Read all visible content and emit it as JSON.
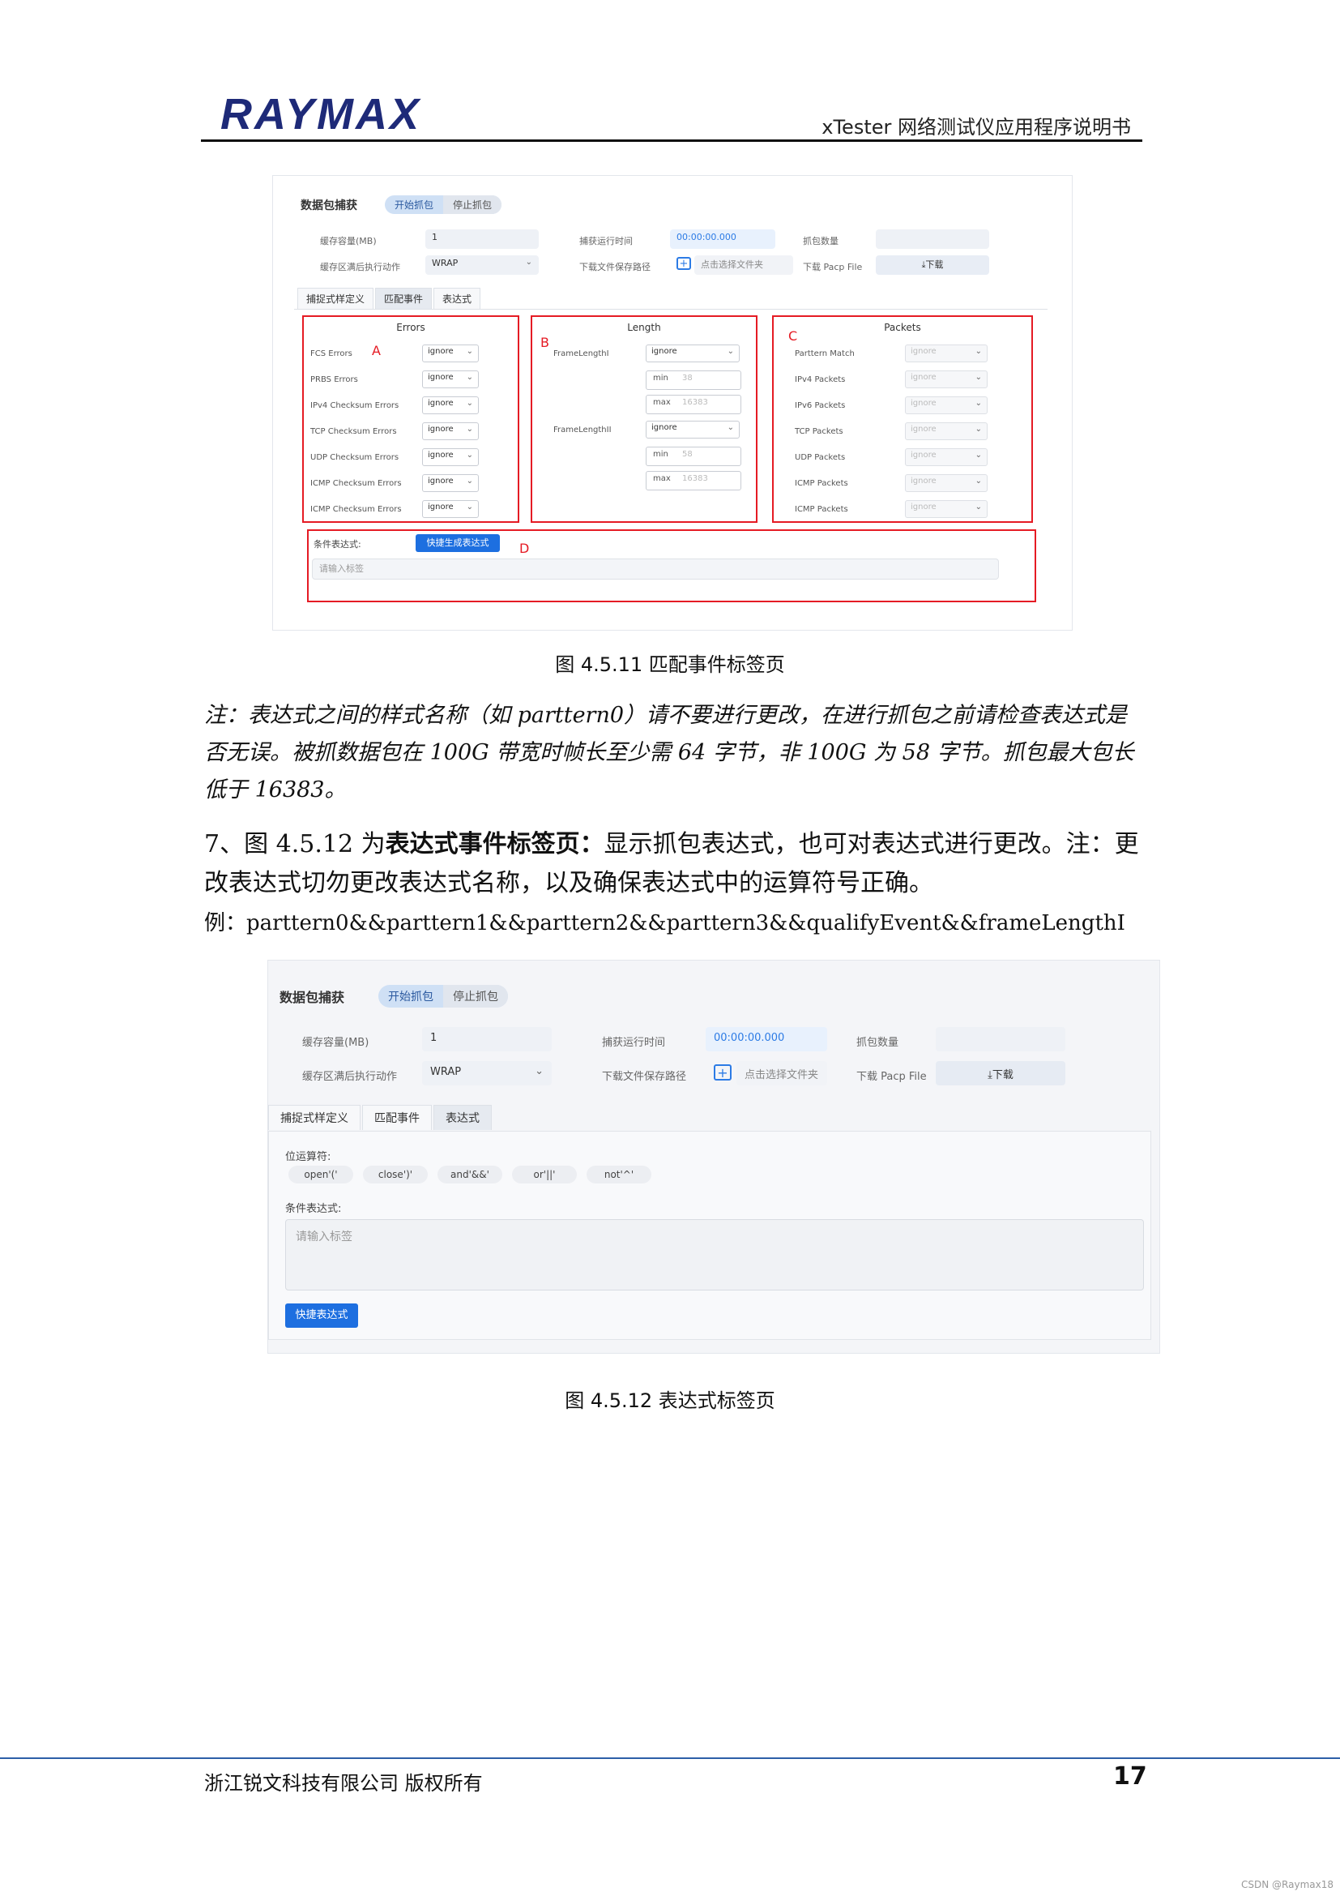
{
  "header": {
    "logo_text": "RAYMAX",
    "doc_title": "xTester 网络测试仪应用程序说明书"
  },
  "shot1": {
    "title": "数据包捕获",
    "start_btn": "开始抓包",
    "stop_btn": "停止抓包",
    "cache_label": "缓存容量(MB)",
    "cache_value": "1",
    "runtime_label": "捕获运行时间",
    "runtime_value": "00:00:00.000",
    "count_label": "抓包数量",
    "count_value": "",
    "action_label": "缓存区满后执行动作",
    "action_value": "WRAP",
    "path_label": "下载文件保存路径",
    "path_value": "点击选择文件夹",
    "pcap_label": "下载 Pacp File",
    "download_btn": "⤓下载",
    "tabs": [
      "捕捉式样定义",
      "匹配事件",
      "表达式"
    ],
    "errors": {
      "heading": "Errors",
      "box_label": "A",
      "rows": [
        {
          "label": "FCS Errors",
          "value": "ignore"
        },
        {
          "label": "PRBS Errors",
          "value": "ignore"
        },
        {
          "label": "IPv4 Checksum Errors",
          "value": "ignore"
        },
        {
          "label": "TCP Checksum Errors",
          "value": "ignore"
        },
        {
          "label": "UDP Checksum Errors",
          "value": "ignore"
        },
        {
          "label": "ICMP Checksum Errors",
          "value": "ignore"
        },
        {
          "label": "ICMP Checksum Errors",
          "value": "ignore"
        }
      ]
    },
    "length": {
      "heading": "Length",
      "box_label": "B",
      "groups": [
        {
          "label": "FrameLengthI",
          "value": "ignore",
          "min_label": "min",
          "min": "38",
          "max_label": "max",
          "max": "16383"
        },
        {
          "label": "FrameLengthII",
          "value": "ignore",
          "min_label": "min",
          "min": "58",
          "max_label": "max",
          "max": "16383"
        }
      ]
    },
    "packets": {
      "heading": "Packets",
      "box_label": "C",
      "rows": [
        {
          "label": "Parttern Match",
          "value": "ignore"
        },
        {
          "label": "IPv4 Packets",
          "value": "ignore"
        },
        {
          "label": "IPv6 Packets",
          "value": "ignore"
        },
        {
          "label": "TCP Packets",
          "value": "ignore"
        },
        {
          "label": "UDP Packets",
          "value": "ignore"
        },
        {
          "label": "ICMP Packets",
          "value": "ignore"
        },
        {
          "label": "ICMP Packets",
          "value": "ignore"
        }
      ]
    },
    "condition": {
      "label": "条件表达式:",
      "quick_btn": "快捷生成表达式",
      "box_label": "D",
      "placeholder": "请输入标签"
    }
  },
  "caption1": "图 4.5.11  匹配事件标签页",
  "note": "注：表达式之间的样式名称（如 parttern0）请不要进行更改，在进行抓包之前请检查表达式是否无误。被抓数据包在 100G 带宽时帧长至少需 64 字节，非 100G 为 58 字节。抓包最大包长低于 16383。",
  "para": {
    "prefix": "7、图 4.5.12 为",
    "bold": "表达式事件标签页：",
    "rest": "显示抓包表达式，也可对表达式进行更改。注：更改表达式切勿更改表达式名称，以及确保表达式中的运算符号正确。"
  },
  "example": "例：parttern0&&parttern1&&parttern2&&parttern3&&qualifyEvent&&frameLengthI",
  "shot2": {
    "title": "数据包捕获",
    "start_btn": "开始抓包",
    "stop_btn": "停止抓包",
    "cache_label": "缓存容量(MB)",
    "cache_value": "1",
    "runtime_label": "捕获运行时间",
    "runtime_value": "00:00:00.000",
    "count_label": "抓包数量",
    "count_value": "",
    "action_label": "缓存区满后执行动作",
    "action_value": "WRAP",
    "path_label": "下载文件保存路径",
    "path_value": "点击选择文件夹",
    "pcap_label": "下载 Pacp File",
    "download_btn": "⤓下载",
    "tabs": [
      "捕捉式样定义",
      "匹配事件",
      "表达式"
    ],
    "bitops_label": "位运算符:",
    "ops": [
      "open'('",
      "close')'",
      "and'&&'",
      "or'||'",
      "not'^'"
    ],
    "condition_label": "条件表达式:",
    "placeholder": "请输入标签",
    "quick_btn": "快捷表达式"
  },
  "caption2": "图 4.5.12  表达式标签页",
  "footer": {
    "company": "浙江锐文科技有限公司  版权所有",
    "page": "17",
    "watermark": "CSDN @Raymax18"
  }
}
